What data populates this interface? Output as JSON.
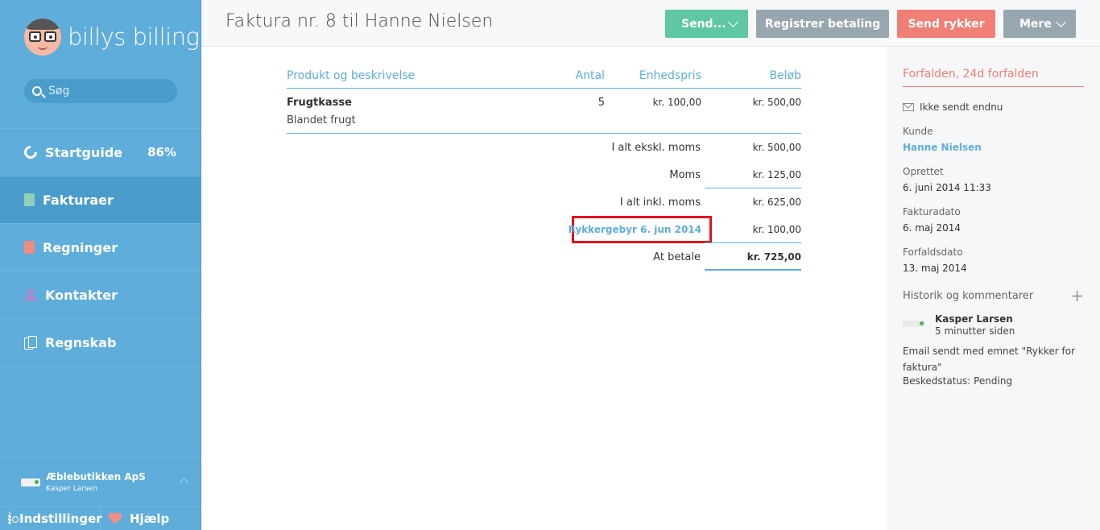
{
  "app": {
    "logo_text": "billys billing"
  },
  "search": {
    "placeholder": "Søg"
  },
  "nav": {
    "startguide": {
      "label": "Startguide",
      "progress": "86%"
    },
    "invoices": {
      "label": "Fakturaer"
    },
    "bills": {
      "label": "Regninger"
    },
    "contacts": {
      "label": "Kontakter"
    },
    "accounting": {
      "label": "Regnskab"
    }
  },
  "company": {
    "name": "Æblebutikken ApS",
    "user": "Kasper Larsen"
  },
  "bottom": {
    "settings": "Indstillinger",
    "help": "Hjælp"
  },
  "header": {
    "title": "Faktura nr. 8 til Hanne Nielsen",
    "send": "Send...",
    "register_payment": "Registrer betaling",
    "send_reminder": "Send rykker",
    "more": "Mere"
  },
  "invoice": {
    "columns": {
      "product": "Produkt og beskrivelse",
      "qty": "Antal",
      "unit_price": "Enhedspris",
      "amount": "Beløb"
    },
    "lines": [
      {
        "name": "Frugtkasse",
        "description": "Blandet frugt",
        "qty": "5",
        "unit_price": "kr. 100,00",
        "amount": "kr. 500,00"
      }
    ],
    "totals": {
      "excl_vat_label": "I alt ekskl. moms",
      "excl_vat": "kr. 500,00",
      "vat_label": "Moms",
      "vat": "kr. 125,00",
      "incl_vat_label": "I alt inkl. moms",
      "incl_vat": "kr. 625,00",
      "fee_label": "Rykkergebyr 6. jun 2014",
      "fee": "kr. 100,00",
      "due_label": "At betale",
      "due": "kr. 725,00"
    }
  },
  "panel": {
    "status": "Forfalden, 24d forfalden",
    "sent_status": "Ikke sendt endnu",
    "customer_label": "Kunde",
    "customer": "Hanne Nielsen",
    "created_label": "Oprettet",
    "created": "6. juni 2014 11:33",
    "invoice_date_label": "Fakturadato",
    "invoice_date": "6. maj 2014",
    "due_date_label": "Forfaldsdato",
    "due_date": "13. maj 2014",
    "history_label": "Historik og kommentarer",
    "history": {
      "author": "Kasper Larsen",
      "time": "5 minutter siden",
      "message": "Email sendt med emnet \"Rykker for faktura\"",
      "status": "Beskedstatus: Pending"
    }
  },
  "colors": {
    "sidebar": "#5fadda",
    "accent": "#5fadda",
    "danger": "#f07f75",
    "success": "#5fc7a2",
    "neutral": "#98a6b0",
    "highlight": "#e0141e"
  }
}
